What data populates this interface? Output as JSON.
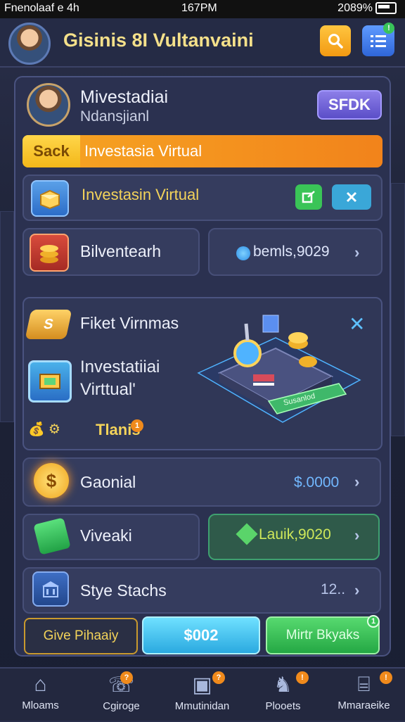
{
  "status_bar": {
    "left": "Fnenolaaf e 4h",
    "time": "167PM",
    "battery": "2089%"
  },
  "header": {
    "title": "Gisinis 8I Vultanvaini",
    "search_icon": "search-icon",
    "menu_icon": "list-icon",
    "menu_badge": "!"
  },
  "profile": {
    "name": "Mivestadiai",
    "subtitle": "Ndansjianl",
    "action_label": "SFDK"
  },
  "banner": {
    "tag": "Sack",
    "text": "Investasia Virtual"
  },
  "row_invest": {
    "label": "Investasin Virtual"
  },
  "row_balance": {
    "left_label": "Bilventearh",
    "right_value": "bemls,9029"
  },
  "feature": {
    "title": "Fiket Virnmas",
    "subtitle_line1": "Investatiiai",
    "subtitle_line2": "Virttual'",
    "mini_label": "Tlanis",
    "mini_badge": "1",
    "coin_label": "S",
    "iso_sign": "Susanlod"
  },
  "row_gaonial": {
    "label": "Gaonial",
    "value": "$.0000"
  },
  "row_viveaki": {
    "label": "Viveaki",
    "value": "Lauik,9020"
  },
  "row_stye": {
    "label": "Stye Stachs",
    "value": "12.."
  },
  "buttons": {
    "give": "Give Pihaaiy",
    "amount": "$002",
    "more": "Mirtr Bkyaks",
    "more_badge": "1"
  },
  "nav": [
    {
      "label": "Mloams",
      "icon": "home-icon",
      "badge": ""
    },
    {
      "label": "Cgiroge",
      "icon": "phone-icon",
      "badge": "?"
    },
    {
      "label": "Mmutinidan",
      "icon": "box-icon",
      "badge": "?"
    },
    {
      "label": "Plooets",
      "icon": "pet-icon",
      "badge": "!"
    },
    {
      "label": "Mmaraeike",
      "icon": "store-icon",
      "badge": "!"
    }
  ],
  "colors": {
    "accent": "#f2831b",
    "gold": "#f3d35a",
    "panel": "#2b3150",
    "nav": "#23283f"
  }
}
